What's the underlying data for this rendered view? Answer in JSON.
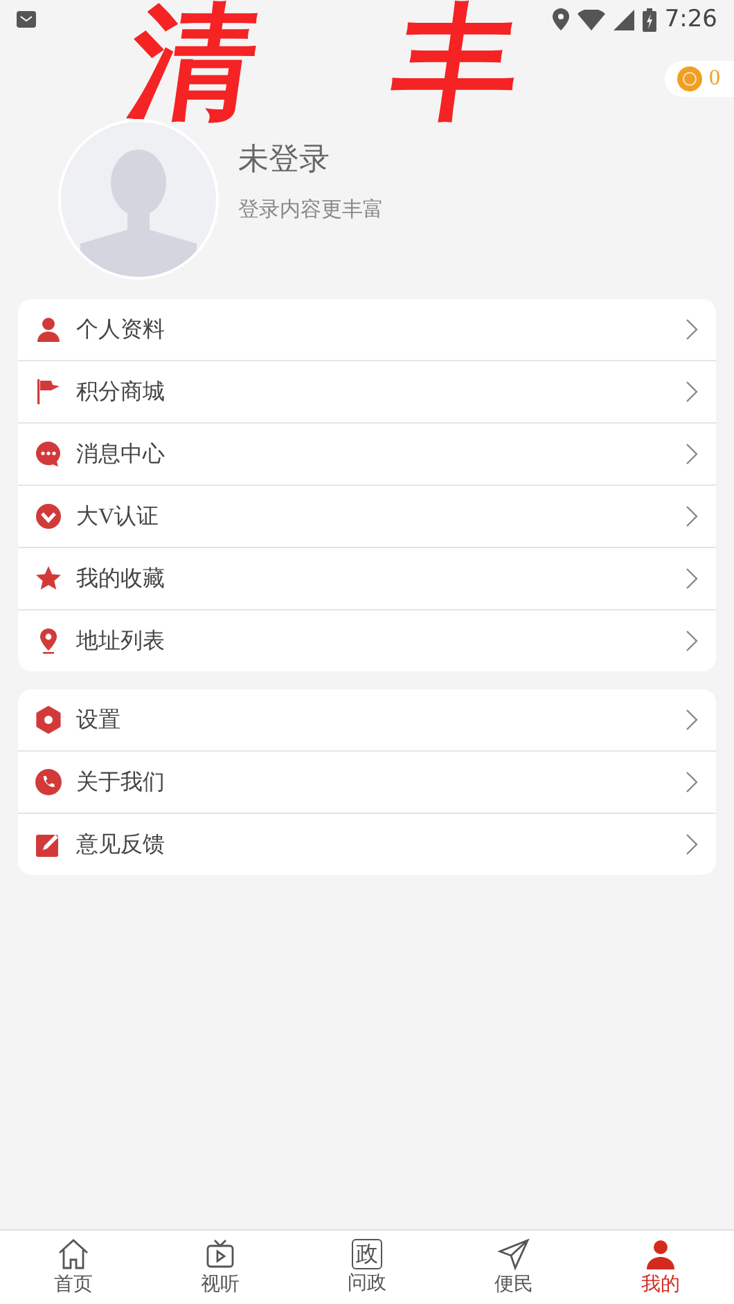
{
  "status_bar": {
    "time": "7:26"
  },
  "header": {
    "art": [
      "清",
      "丰"
    ],
    "coins": "0",
    "name": "未登录",
    "subtitle": "登录内容更丰富"
  },
  "menu_groups": [
    {
      "items": [
        {
          "kind": "person",
          "label": "个人资料"
        },
        {
          "kind": "flag",
          "label": "积分商城"
        },
        {
          "kind": "chat",
          "label": "消息中心"
        },
        {
          "kind": "badge",
          "label": "大V认证"
        },
        {
          "kind": "star",
          "label": "我的收藏"
        },
        {
          "kind": "pin",
          "label": "地址列表"
        }
      ]
    },
    {
      "items": [
        {
          "kind": "gear",
          "label": "设置"
        },
        {
          "kind": "phone",
          "label": "关于我们"
        },
        {
          "kind": "edit",
          "label": "意见反馈"
        }
      ]
    }
  ],
  "bottom_nav": [
    {
      "kind": "home",
      "label": "首页",
      "selected": false
    },
    {
      "kind": "tv",
      "label": "视听",
      "selected": false
    },
    {
      "kind": "glyph",
      "icon_text": "政",
      "label": "问政",
      "selected": false
    },
    {
      "kind": "send",
      "label": "便民",
      "selected": false
    },
    {
      "kind": "person",
      "label": "我的",
      "selected": true
    }
  ]
}
